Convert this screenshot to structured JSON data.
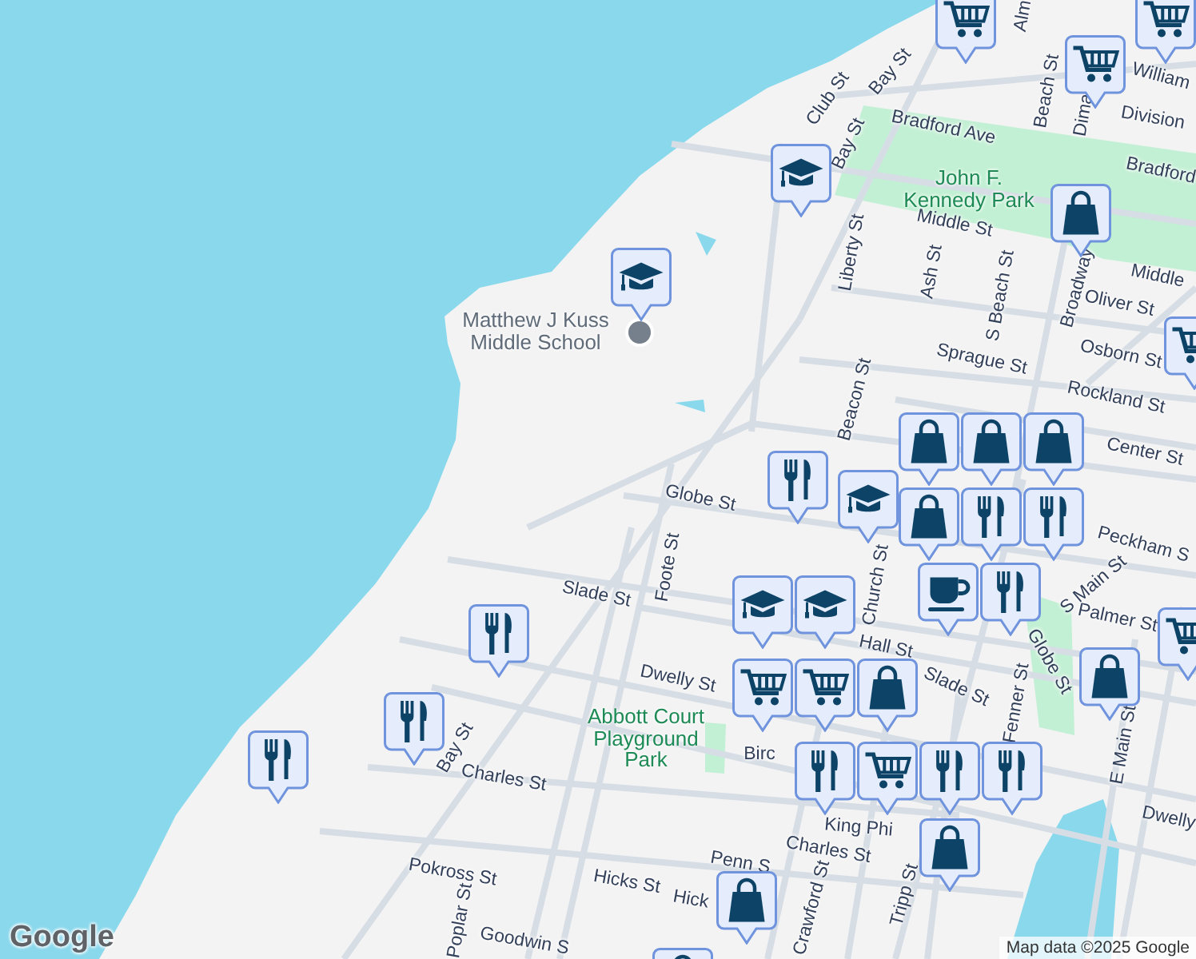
{
  "map": {
    "street_labels": [
      "Alm",
      "Club St",
      "Bay St",
      "Bay St",
      "Beach St",
      "Dima",
      "William",
      "Division",
      "Bradford Ave",
      "Bradford",
      "Middle St",
      "Middle",
      "Liberty St",
      "Ash St",
      "S Beach St",
      "Broadway",
      "Oliver St",
      "Osborn St",
      "Sprague St",
      "Rockland St",
      "Center St",
      "Beacon St",
      "Globe St",
      "Peckham S",
      "Palmer St",
      "S Main St",
      "Church St",
      "Globe St",
      "Hall St",
      "Slade St",
      "Foote St",
      "Dwelly St",
      "Slade St",
      "Fenner St",
      "E Main St",
      "Dwelly",
      "Birc",
      "King Phi",
      "Charles St",
      "Penn S",
      "Hicks St",
      "Hick",
      "Crawford St",
      "Tripp St",
      "Bay St",
      "Charles St",
      "Pokross St",
      "Poplar St",
      "Goodwin S"
    ],
    "place_labels": [
      {
        "kind": "park",
        "text": "John F.\nKennedy Park"
      },
      {
        "kind": "park",
        "text": "Abbott Court\nPlayground\nPark"
      },
      {
        "kind": "school",
        "text": "Matthew J Kuss\nMiddle School"
      }
    ],
    "pins": [
      {
        "kind": "cart"
      },
      {
        "kind": "cart"
      },
      {
        "kind": "cart"
      },
      {
        "kind": "school"
      },
      {
        "kind": "bag"
      },
      {
        "kind": "school"
      },
      {
        "kind": "cart"
      },
      {
        "kind": "restaurant"
      },
      {
        "kind": "school"
      },
      {
        "kind": "bag"
      },
      {
        "kind": "bag"
      },
      {
        "kind": "bag"
      },
      {
        "kind": "bag"
      },
      {
        "kind": "restaurant"
      },
      {
        "kind": "restaurant"
      },
      {
        "kind": "restaurant"
      },
      {
        "kind": "cafe"
      },
      {
        "kind": "school"
      },
      {
        "kind": "school"
      },
      {
        "kind": "cart"
      },
      {
        "kind": "restaurant"
      },
      {
        "kind": "bag"
      },
      {
        "kind": "bag"
      },
      {
        "kind": "cart"
      },
      {
        "kind": "cart"
      },
      {
        "kind": "cart"
      },
      {
        "kind": "restaurant"
      },
      {
        "kind": "restaurant"
      },
      {
        "kind": "restaurant"
      },
      {
        "kind": "restaurant"
      },
      {
        "kind": "restaurant"
      },
      {
        "kind": "bag"
      },
      {
        "kind": "bag"
      },
      {
        "kind": "bag"
      }
    ]
  },
  "attribution": "Map data ©2025 Google",
  "logo": "Google"
}
